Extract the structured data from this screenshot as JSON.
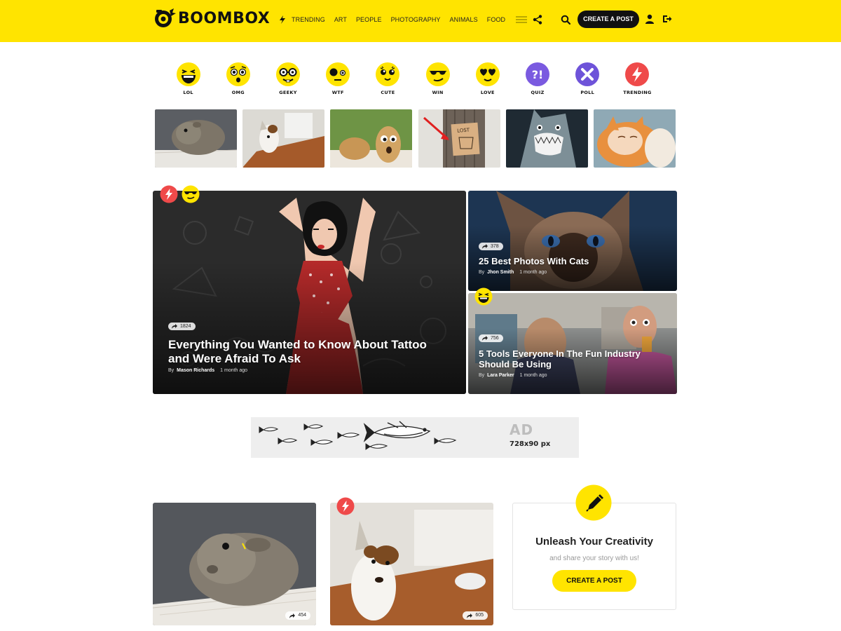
{
  "header": {
    "logo_text": "BOOMBOX",
    "nav": [
      "Trending",
      "Art",
      "People",
      "Photography",
      "Animals",
      "Food"
    ],
    "create_label": "Create a post"
  },
  "reactions": [
    "LOL",
    "OMG",
    "GEEKY",
    "WTF",
    "CUTE",
    "WIN",
    "LOVE",
    "QUIZ",
    "POLL",
    "TRENDING"
  ],
  "featured": {
    "main": {
      "shares": "1824",
      "title": "Everything You Wanted to Know About Tattoo and Were Afraid To Ask",
      "by": "By",
      "author": "Mason Richards",
      "time": "1 month ago"
    },
    "side1": {
      "shares": "378",
      "title": "25 Best Photos With Cats",
      "by": "By",
      "author": "Jhon Smith",
      "time": "1 month ago"
    },
    "side2": {
      "shares": "756",
      "title": "5 Tools Everyone In The Fun Industry Should Be Using",
      "by": "By",
      "author": "Lara Parker",
      "time": "1 month ago"
    }
  },
  "ad": {
    "label": "AD",
    "size": "728x90 px"
  },
  "bottom": {
    "card1_shares": "454",
    "card2_shares": "605"
  },
  "promo": {
    "title": "Unleash Your Creativity",
    "subtitle": "and share your story with us!",
    "button": "Create a post"
  },
  "colors": {
    "brand_yellow": "#ffe400",
    "trending_red": "#ef4a4a",
    "quiz_purple": "#7a5ae0",
    "poll_purple": "#6e53d9",
    "dark": "#111111"
  }
}
